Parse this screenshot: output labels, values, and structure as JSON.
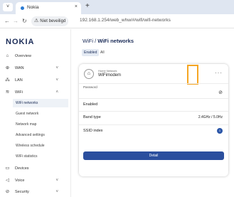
{
  "browser": {
    "tab_title": "Nokia",
    "tab_close": "×",
    "new_tab": "+",
    "tab_menu_icon": "˅",
    "security_label": "Niet beveiligd",
    "url": "192.168.1.254/web_whw/#/wifi/wifi-networks"
  },
  "sidebar": {
    "logo": "NOKIA",
    "items": {
      "overview": {
        "label": "Overview",
        "icon": "⌂"
      },
      "wan": {
        "label": "WAN",
        "icon": "⊕",
        "chevron": "˅"
      },
      "lan": {
        "label": "LAN",
        "icon": "⁂",
        "chevron": "˅"
      },
      "wifi": {
        "label": "WiFi",
        "icon": "≋",
        "chevron": "˄"
      },
      "devices": {
        "label": "Devices",
        "icon": "▭"
      },
      "voice": {
        "label": "Voice",
        "icon": "◁",
        "chevron": "˅"
      },
      "security": {
        "label": "Security",
        "icon": "⊘",
        "chevron": "˅"
      }
    },
    "wifi_sub": [
      "WiFi networks",
      "Guest network",
      "Network map",
      "Advanced settings",
      "Wireless schedule",
      "WiFi statistics"
    ]
  },
  "main": {
    "title_prefix": "WiFi / ",
    "title_bold": "WiFi networks",
    "tabs": [
      "Enabled",
      "All"
    ]
  },
  "card": {
    "network_label": "Home Network",
    "network_name": "WiFimodem",
    "more_icon": "···",
    "password_label": "Password",
    "eye_icon": "⊘",
    "enabled_label": "Enabled",
    "band_label": "Band type",
    "band_value": "2.4GHz / 5.0Hz",
    "ssid_label": "SSID index",
    "ssid_value": "1",
    "detail_button": "Detail"
  },
  "colors": {
    "accent": "#2b4f9e",
    "highlight": "#f5a623",
    "logo": "#1a2b57"
  }
}
